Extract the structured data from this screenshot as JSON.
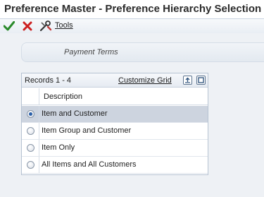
{
  "window": {
    "title": "Preference Master - Preference Hierarchy Selection"
  },
  "toolbar": {
    "ok_icon": "checkmark-icon",
    "cancel_icon": "x-icon",
    "tools_icon": "tools-icon",
    "tools_label": "Tools",
    "colors": {
      "ok": "#2a8a2a",
      "cancel": "#cc1f1f"
    }
  },
  "form": {
    "field_label": "Payment Terms"
  },
  "grid": {
    "records_label": "Records 1 - 4",
    "customize_label": "Customize Grid",
    "export_icon": "export-icon",
    "maximize_icon": "maximize-icon",
    "columns": [
      "Description"
    ],
    "rows": [
      {
        "description": "Item and Customer",
        "selected": true
      },
      {
        "description": "Item Group and Customer",
        "selected": false
      },
      {
        "description": "Item Only",
        "selected": false
      },
      {
        "description": "All Items and All Customers",
        "selected": false
      }
    ]
  }
}
